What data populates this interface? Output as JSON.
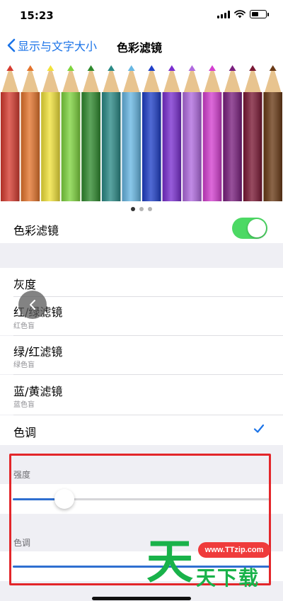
{
  "status_bar": {
    "time": "15:23",
    "icons": [
      "signal-icon",
      "wifi-icon",
      "battery-icon"
    ]
  },
  "nav": {
    "back_label": "显示与文字大小",
    "title": "色彩滤镜"
  },
  "preview": {
    "pencil_colors": [
      "#d63b2f",
      "#e4742c",
      "#f1e23a",
      "#7ed43e",
      "#2f8a2e",
      "#2a8a86",
      "#67b7e3",
      "#1f3fc8",
      "#7a2ed0",
      "#b06adf",
      "#d43fd0",
      "#7a1f7e",
      "#7a1834",
      "#6a3a16"
    ],
    "page_count": 3,
    "active_page": 1
  },
  "color_filters": {
    "label": "色彩滤镜",
    "enabled": true,
    "accent": "#4cd964"
  },
  "filters": [
    {
      "label": "灰度",
      "sub": ""
    },
    {
      "label": "红/绿滤镜",
      "sub": "红色盲"
    },
    {
      "label": "绿/红滤镜",
      "sub": "绿色盲"
    },
    {
      "label": "蓝/黄滤镜",
      "sub": "蓝色盲"
    },
    {
      "label": "色调",
      "sub": "",
      "selected": true
    }
  ],
  "intensity": {
    "header": "强度",
    "value_fraction": 0.2
  },
  "hue": {
    "header": "色调",
    "value_fraction": 1.0
  },
  "watermark": {
    "url": "www.TTzip.com",
    "big_char": "天",
    "text": "天下载"
  }
}
